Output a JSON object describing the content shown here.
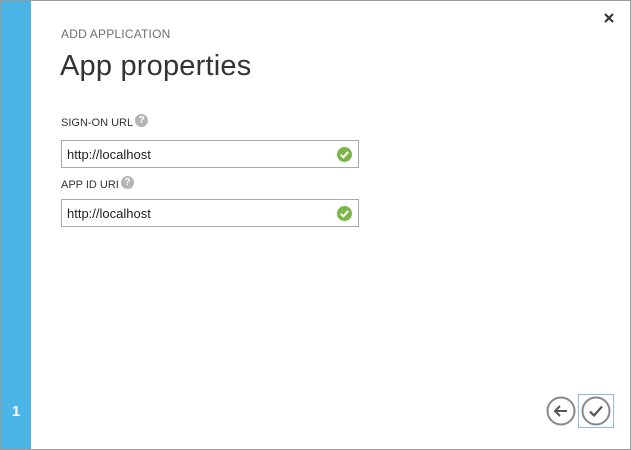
{
  "dialog": {
    "eyebrow": "ADD APPLICATION",
    "title": "App properties",
    "step_number": "1"
  },
  "fields": {
    "sign_on_url": {
      "label": "SIGN-ON URL",
      "value": "http://localhost",
      "help_glyph": "?",
      "status": "valid"
    },
    "app_id_uri": {
      "label": "APP ID URI",
      "value": "http://localhost",
      "help_glyph": "?",
      "status": "valid"
    }
  },
  "icons": {
    "close": "close-icon",
    "help": "help-icon",
    "valid": "check-circle-icon",
    "back": "arrow-left-icon",
    "finish": "checkmark-icon"
  },
  "colors": {
    "rail": "#4ab4e6",
    "valid": "#7ab648",
    "help": "#b4b4b4",
    "nav_circle": "#888888",
    "focus_frame": "#8fbde0"
  }
}
